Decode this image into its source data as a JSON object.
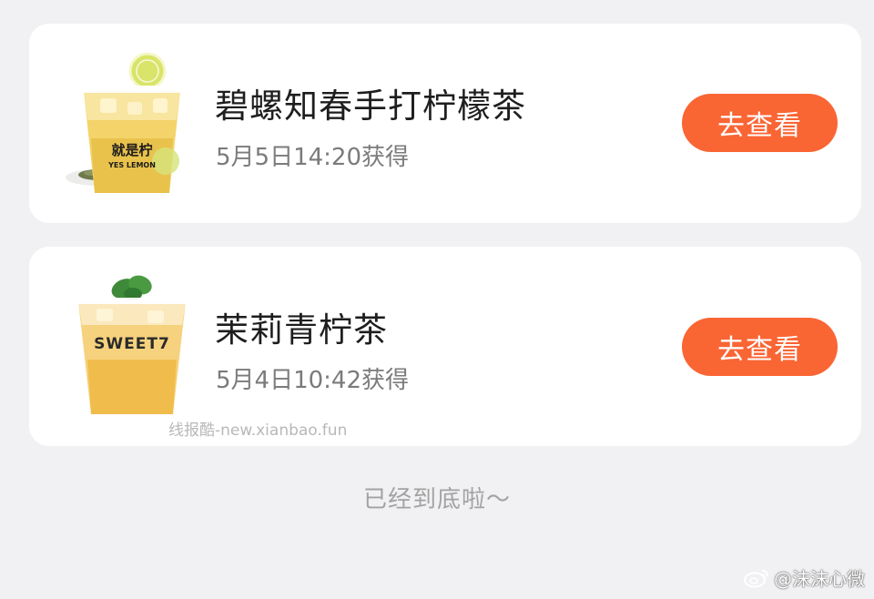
{
  "colors": {
    "background": "#f1f1f3",
    "card": "#ffffff",
    "accent": "#fa6534",
    "title_text": "#1e1e1e",
    "time_text": "#7b7b7b"
  },
  "items": [
    {
      "title": "碧螺知春手打柠檬茶",
      "time": "5月5日14:20获得",
      "button_label": "去查看",
      "cup_brand_text": "就是柠",
      "cup_brand_sub": "YES LEMON"
    },
    {
      "title": "茉莉青柠茶",
      "time": "5月4日10:42获得",
      "button_label": "去查看",
      "cup_brand_text": "SWEET7"
    }
  ],
  "watermark_site": "线报酷-new.xianbao.fun",
  "end_text": "已经到底啦～",
  "weibo_mark": "@沫沫心微"
}
